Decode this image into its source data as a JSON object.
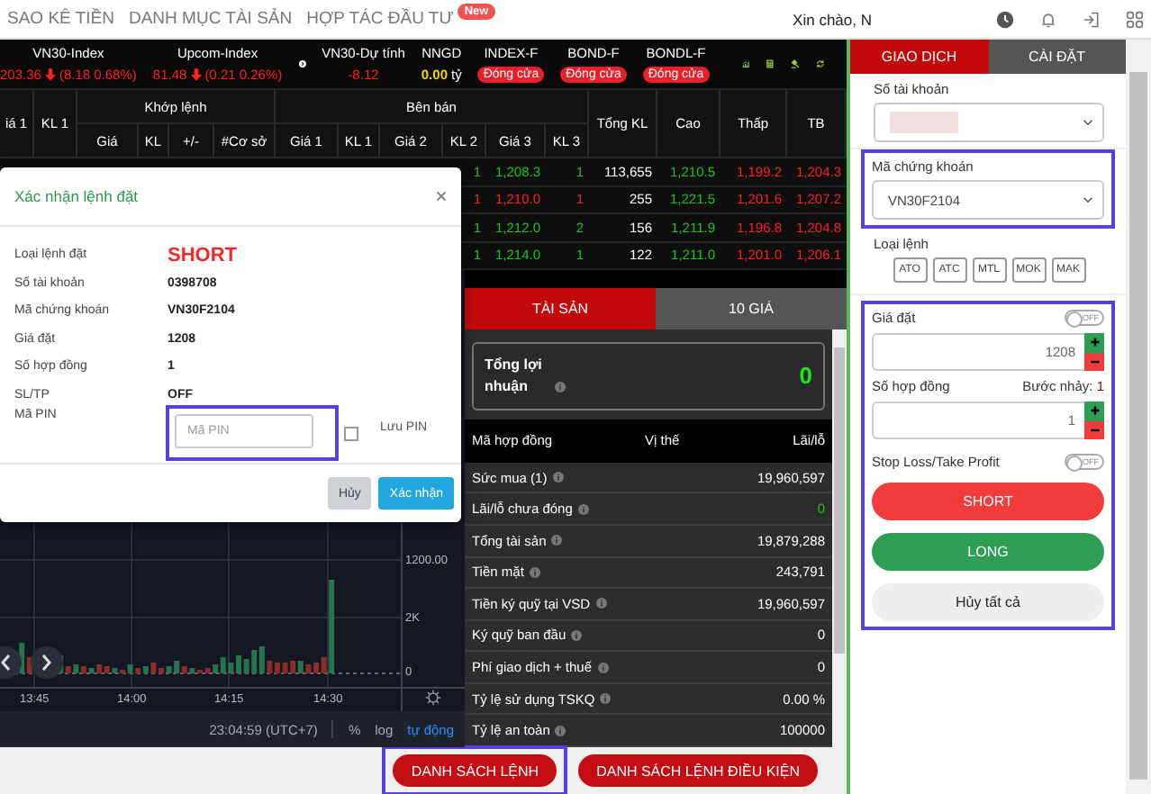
{
  "nav": {
    "links": [
      {
        "label": "SAO KÊ TIỀN"
      },
      {
        "label": "DANH MỤC TÀI SẢN"
      },
      {
        "label": "HỢP TÁC ĐẦU TƯ",
        "badge": "New"
      }
    ],
    "greeting": "Xin chào, N"
  },
  "indices": [
    {
      "name": "VN30-Index",
      "value": "203.36",
      "change": "(8.18 0.68%)"
    },
    {
      "name": "Upcom-Index",
      "value": "81.48",
      "change": "(0.21 0.26%)"
    }
  ],
  "forecast": {
    "name": "VN30-Dự tính",
    "value": "-8.12"
  },
  "foreign": {
    "name": "NNGD",
    "value": "0.00",
    "unit": "tỷ"
  },
  "markets": [
    {
      "name": "INDEX-F",
      "status": "Đóng cửa"
    },
    {
      "name": "BOND-F",
      "status": "Đóng cửa"
    },
    {
      "name": "BONDL-F",
      "status": "Đóng cửa"
    }
  ],
  "table": {
    "columns": [
      {
        "label": "iá 1"
      },
      {
        "label": "KL 1"
      },
      {
        "label": "Khớp lệnh",
        "children": [
          {
            "label": "Giá"
          },
          {
            "label": "KL"
          },
          {
            "label": "+/-"
          },
          {
            "label": "#Cơ sở"
          }
        ]
      },
      {
        "label": "Bên bán",
        "children": [
          {
            "label": "Giá 1"
          },
          {
            "label": "KL 1"
          },
          {
            "label": "Giá 2"
          },
          {
            "label": "KL 2"
          },
          {
            "label": "Giá 3"
          },
          {
            "label": "KL 3"
          }
        ]
      },
      {
        "label": "Tổng KL"
      },
      {
        "label": "Cao"
      },
      {
        "label": "Thấp"
      },
      {
        "label": "TB"
      }
    ],
    "rows": [
      {
        "cells": [
          {
            "text": ""
          },
          {
            "text": ""
          },
          {
            "text": ""
          },
          {
            "text": ""
          },
          {
            "text": ""
          },
          {
            "text": ""
          },
          {
            "text": ""
          },
          {
            "text": ""
          },
          {
            "text": ""
          },
          {
            "text": "1",
            "color": "#19c819"
          },
          {
            "text": "1,208.3",
            "color": "#19c819"
          },
          {
            "text": "1",
            "color": "#19c819"
          },
          {
            "text": "113,655",
            "color": "#ffffff"
          },
          {
            "text": "1,210.5",
            "color": "#19c819"
          },
          {
            "text": "1,199.2",
            "color": "#ff2020"
          },
          {
            "text": "1,204.3",
            "color": "#ff2020"
          }
        ]
      },
      {
        "cells": [
          {
            "text": ""
          },
          {
            "text": ""
          },
          {
            "text": ""
          },
          {
            "text": ""
          },
          {
            "text": ""
          },
          {
            "text": ""
          },
          {
            "text": ""
          },
          {
            "text": ""
          },
          {
            "text": ""
          },
          {
            "text": "1",
            "color": "#ff2020"
          },
          {
            "text": "1,210.0",
            "color": "#ff2020"
          },
          {
            "text": "1",
            "color": "#ff2020"
          },
          {
            "text": "255",
            "color": "#ffffff"
          },
          {
            "text": "1,221.5",
            "color": "#19c819"
          },
          {
            "text": "1,201.6",
            "color": "#ff2020"
          },
          {
            "text": "1,207.2",
            "color": "#ff2020"
          }
        ]
      },
      {
        "cells": [
          {
            "text": ""
          },
          {
            "text": ""
          },
          {
            "text": ""
          },
          {
            "text": ""
          },
          {
            "text": ""
          },
          {
            "text": ""
          },
          {
            "text": ""
          },
          {
            "text": ""
          },
          {
            "text": ""
          },
          {
            "text": "1",
            "color": "#19c819"
          },
          {
            "text": "1,212.0",
            "color": "#19c819"
          },
          {
            "text": "2",
            "color": "#19c819"
          },
          {
            "text": "156",
            "color": "#ffffff"
          },
          {
            "text": "1,211.9",
            "color": "#19c819"
          },
          {
            "text": "1,196.8",
            "color": "#ff2020"
          },
          {
            "text": "1,204.8",
            "color": "#ff2020"
          }
        ]
      },
      {
        "cells": [
          {
            "text": ""
          },
          {
            "text": ""
          },
          {
            "text": ""
          },
          {
            "text": ""
          },
          {
            "text": ""
          },
          {
            "text": ""
          },
          {
            "text": ""
          },
          {
            "text": ""
          },
          {
            "text": ""
          },
          {
            "text": "1",
            "color": "#19c819"
          },
          {
            "text": "1,214.0",
            "color": "#19c819"
          },
          {
            "text": "1",
            "color": "#19c819"
          },
          {
            "text": "122",
            "color": "#ffffff"
          },
          {
            "text": "1,211.0",
            "color": "#19c819"
          },
          {
            "text": "1,201.0",
            "color": "#ff2020"
          },
          {
            "text": "1,206.1",
            "color": "#ff2020"
          }
        ]
      }
    ]
  },
  "chart": {
    "y_labels": [
      "1200.00",
      "2K",
      "0"
    ],
    "x_labels": [
      "13:45",
      "14:00",
      "14:15",
      "14:30"
    ]
  },
  "chart_toolbar": {
    "time": "23:04:59 (UTC+7)",
    "scales": [
      {
        "label": "%",
        "selected": false
      },
      {
        "label": "log",
        "selected": false
      },
      {
        "label": "tự động",
        "selected": true
      }
    ]
  },
  "asset_tabs": [
    {
      "label": "TÀI SẢN",
      "selected": true
    },
    {
      "label": "10 GIÁ",
      "selected": false
    }
  ],
  "profit": {
    "label": "Tổng lợi nhuận",
    "value": "0"
  },
  "positions_header": [
    "Mã hợp đồng",
    "Vị thế",
    "Lãi/lỗ"
  ],
  "asset_rows": [
    {
      "label": "Sức mua (1)",
      "value": "19,960,597",
      "color": "#ffffff"
    },
    {
      "label": "Lãi/lỗ chưa đóng",
      "value": "0",
      "color": "#19c819"
    },
    {
      "label": "Tổng tài sản",
      "value": "19,879,288",
      "color": "#ffffff"
    },
    {
      "label": "Tiền mặt",
      "value": "243,791",
      "color": "#ffffff"
    },
    {
      "label": "Tiền ký quỹ tại VSD",
      "value": "19,960,597",
      "color": "#ffffff"
    },
    {
      "label": "Ký quỹ ban đầu",
      "value": "0",
      "color": "#ffffff"
    },
    {
      "label": "Phí giao dịch + thuế",
      "value": "0",
      "color": "#ffffff"
    },
    {
      "label": "Tỷ lệ sử dụng TSKQ",
      "value": "0.00 %",
      "color": "#ffffff"
    },
    {
      "label": "Tỷ lệ an toàn",
      "value": "100000",
      "color": "#ffffff"
    }
  ],
  "order_lists": [
    {
      "label": "DANH SÁCH LỆNH",
      "highlighted": true
    },
    {
      "label": "DANH SÁCH LỆNH ĐIỀU KIỆN",
      "highlighted": false
    }
  ],
  "modal": {
    "title": "Xác nhận lệnh đặt",
    "fields": [
      {
        "label": "Loại lệnh đặt",
        "value": "SHORT",
        "kind": "side"
      },
      {
        "label": "Số tài khoản",
        "value": "0398708",
        "kind": "plain"
      },
      {
        "label": "Mã chứng khoán",
        "value": "VN30F2104",
        "kind": "plain"
      },
      {
        "label": "Giá đặt",
        "value": "1208",
        "kind": "plain"
      },
      {
        "label": "Số hợp đồng",
        "value": "1",
        "kind": "plain"
      },
      {
        "label": "SL/TP",
        "value": "OFF",
        "kind": "plain"
      }
    ],
    "pin": {
      "label": "Mã PIN",
      "placeholder": "Mã PIN",
      "highlighted": true
    },
    "save_pin": {
      "label": "Lưu PIN",
      "checked": false
    },
    "buttons": [
      {
        "label": "Hủy",
        "kind": "secondary"
      },
      {
        "label": "Xác nhận",
        "kind": "primary"
      }
    ]
  },
  "order_tabs": [
    {
      "label": "GIAO DỊCH",
      "selected": true
    },
    {
      "label": "CÀI ĐẶT",
      "selected": false
    }
  ],
  "account": {
    "label": "Số tài khoản",
    "redacted": true
  },
  "symbol": {
    "label": "Mã chứng khoán",
    "value": "VN30F2104",
    "highlighted": true
  },
  "order_types": {
    "label": "Loại lệnh",
    "options": [
      {
        "label": "ATO"
      },
      {
        "label": "ATC"
      },
      {
        "label": "MTL"
      },
      {
        "label": "MOK"
      },
      {
        "label": "MAK"
      }
    ]
  },
  "entry_highlighted": true,
  "price": {
    "label": "Giá đặt",
    "toggle": {
      "label": "OFF",
      "on": false
    },
    "value": "1208"
  },
  "quantity": {
    "label": "Số hợp đồng",
    "step_label": "Bước nhảy:",
    "step": "1",
    "value": "1"
  },
  "sltp": {
    "label": "Stop Loss/Take Profit",
    "toggle": {
      "label": "OFF",
      "on": false
    }
  },
  "actions": [
    {
      "label": "SHORT",
      "kind": "short"
    },
    {
      "label": "LONG",
      "kind": "long"
    },
    {
      "label": "Hủy tất cả",
      "kind": "cancel"
    }
  ]
}
